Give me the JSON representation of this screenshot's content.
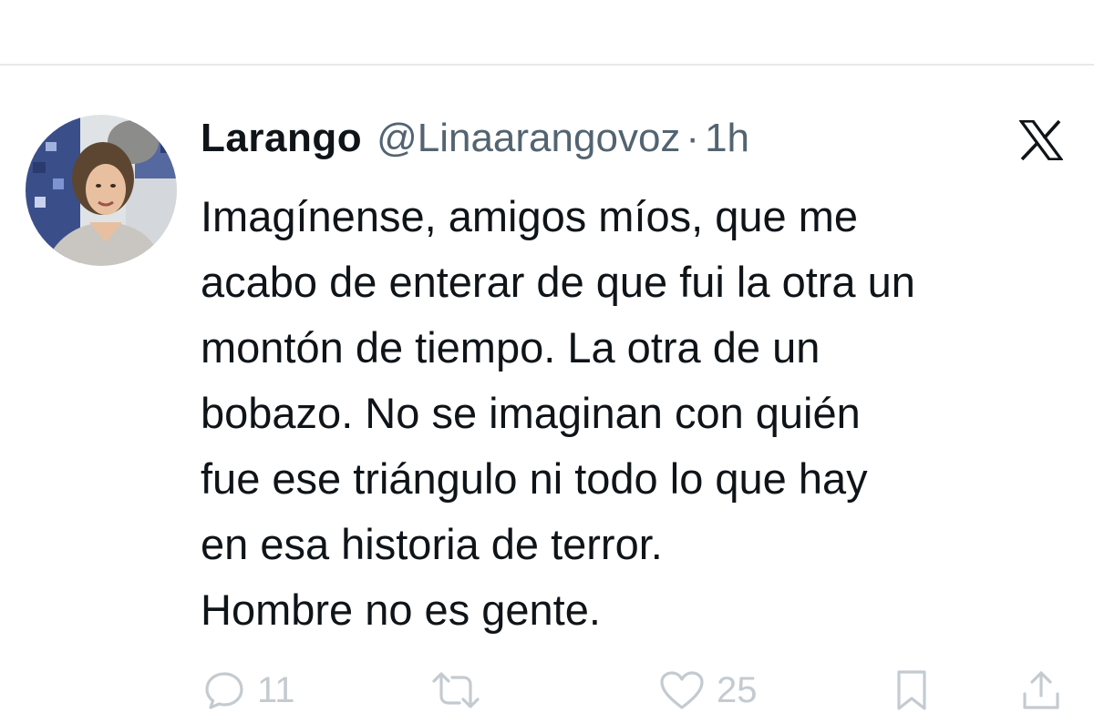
{
  "tweet": {
    "display_name": "Larango",
    "handle": "@Linaarangovoz",
    "separator": "·",
    "time": "1h",
    "lines": [
      "Imagínense, amigos míos, que me",
      "acabo de enterar de que fui la otra un",
      "montón de tiempo. La otra de un",
      "bobazo. No se imaginan con quién",
      "fue ese triángulo ni todo lo que hay",
      "en esa historia de terror.",
      "Hombre no es gente."
    ]
  },
  "actions": {
    "reply_count": "11",
    "like_count": "25"
  },
  "icons": {
    "brand": "x-logo-icon",
    "reply": "reply-icon",
    "retweet": "retweet-icon",
    "like": "heart-icon",
    "bookmark": "bookmark-icon",
    "share": "share-icon"
  },
  "colors": {
    "text": "#0f1419",
    "secondary": "#536471",
    "action_icons": "#c4cbd0",
    "divider": "#e7e9ea"
  }
}
